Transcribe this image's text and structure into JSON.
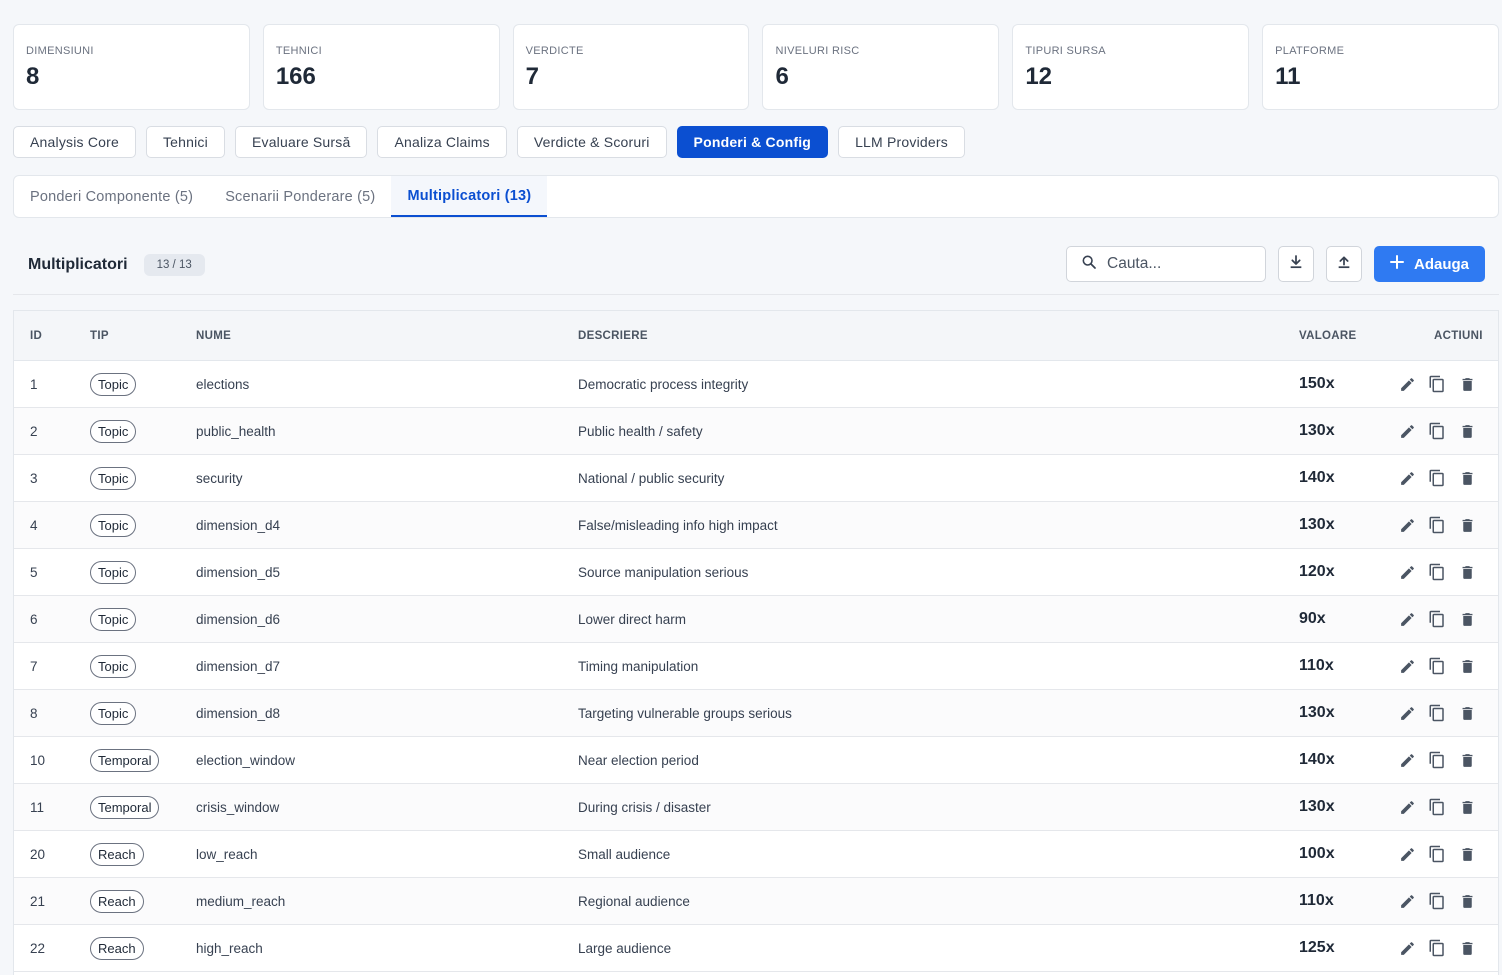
{
  "stats": [
    {
      "label": "DIMENSIUNI",
      "value": "8"
    },
    {
      "label": "TEHNICI",
      "value": "166"
    },
    {
      "label": "VERDICTE",
      "value": "7"
    },
    {
      "label": "NIVELURI RISC",
      "value": "6"
    },
    {
      "label": "TIPURI SURSA",
      "value": "12"
    },
    {
      "label": "PLATFORME",
      "value": "11"
    }
  ],
  "main_tabs": [
    {
      "label": "Analysis Core"
    },
    {
      "label": "Tehnici"
    },
    {
      "label": "Evaluare Sursă"
    },
    {
      "label": "Analiza Claims"
    },
    {
      "label": "Verdicte & Scoruri"
    },
    {
      "label": "Ponderi & Config",
      "active": true
    },
    {
      "label": "LLM Providers"
    }
  ],
  "sub_tabs": [
    {
      "label": "Ponderi Componente (5)"
    },
    {
      "label": "Scenarii Ponderare (5)"
    },
    {
      "label": "Multiplicatori (13)",
      "active": true
    }
  ],
  "panel": {
    "title": "Multiplicatori",
    "count": "13 / 13",
    "search_placeholder": "Cauta...",
    "add_label": "Adauga"
  },
  "table": {
    "headers": {
      "id": "ID",
      "tip": "TIP",
      "nume": "NUME",
      "descriere": "DESCRIERE",
      "valoare": "VALOARE",
      "actiuni": "ACTIUNI"
    },
    "rows": [
      {
        "id": "1",
        "tip": "Topic",
        "nume": "elections",
        "descriere": "Democratic process integrity",
        "valoare": "150x"
      },
      {
        "id": "2",
        "tip": "Topic",
        "nume": "public_health",
        "descriere": "Public health / safety",
        "valoare": "130x"
      },
      {
        "id": "3",
        "tip": "Topic",
        "nume": "security",
        "descriere": "National / public security",
        "valoare": "140x"
      },
      {
        "id": "4",
        "tip": "Topic",
        "nume": "dimension_d4",
        "descriere": "False/misleading info high impact",
        "valoare": "130x"
      },
      {
        "id": "5",
        "tip": "Topic",
        "nume": "dimension_d5",
        "descriere": "Source manipulation serious",
        "valoare": "120x"
      },
      {
        "id": "6",
        "tip": "Topic",
        "nume": "dimension_d6",
        "descriere": "Lower direct harm",
        "valoare": "90x"
      },
      {
        "id": "7",
        "tip": "Topic",
        "nume": "dimension_d7",
        "descriere": "Timing manipulation",
        "valoare": "110x"
      },
      {
        "id": "8",
        "tip": "Topic",
        "nume": "dimension_d8",
        "descriere": "Targeting vulnerable groups serious",
        "valoare": "130x"
      },
      {
        "id": "10",
        "tip": "Temporal",
        "nume": "election_window",
        "descriere": "Near election period",
        "valoare": "140x"
      },
      {
        "id": "11",
        "tip": "Temporal",
        "nume": "crisis_window",
        "descriere": "During crisis / disaster",
        "valoare": "130x"
      },
      {
        "id": "20",
        "tip": "Reach",
        "nume": "low_reach",
        "descriere": "Small audience",
        "valoare": "100x"
      },
      {
        "id": "21",
        "tip": "Reach",
        "nume": "medium_reach",
        "descriere": "Regional audience",
        "valoare": "110x"
      },
      {
        "id": "22",
        "tip": "Reach",
        "nume": "high_reach",
        "descriere": "Large audience",
        "valoare": "125x"
      }
    ]
  },
  "icons": {
    "search": "search-icon",
    "download": "download-icon",
    "upload": "upload-icon",
    "add": "plus-icon",
    "edit": "pencil-icon",
    "copy": "copy-icon",
    "delete": "trash-icon"
  },
  "colors": {
    "accent": "#0b4fd1",
    "add_button": "#2f7af2"
  }
}
